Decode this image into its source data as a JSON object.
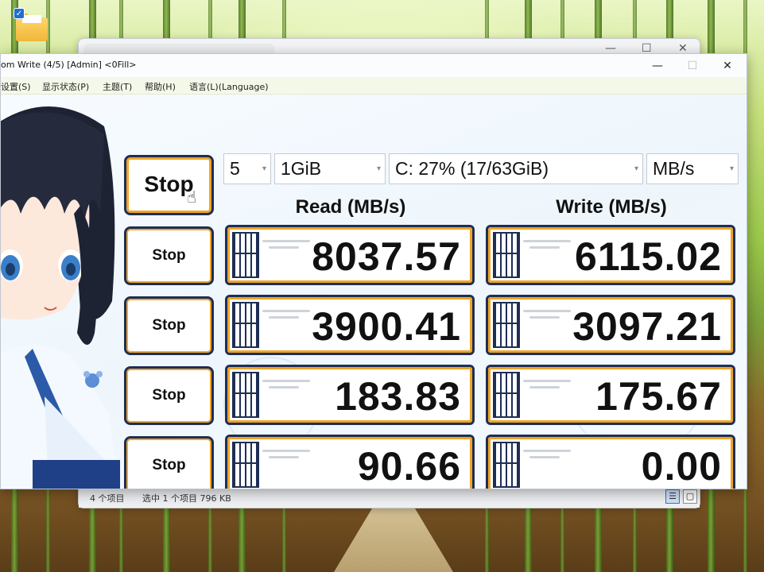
{
  "desktop": {
    "icon_name": "folder-icon"
  },
  "explorer": {
    "status": {
      "item_count": "4 个项目",
      "selection": "选中 1 个项目  796 KB"
    }
  },
  "cdm": {
    "title": "om Write (4/5) [Admin] <0Fill>",
    "window_controls": {
      "minimize": "—",
      "maximize": "☐",
      "close": "✕"
    },
    "menu": [
      "设置(S)",
      "显示状态(P)",
      "主题(T)",
      "帮助(H)",
      "语言(L)(Language)"
    ],
    "main_button_label": "Stop",
    "row_buttons": [
      "Stop",
      "Stop",
      "Stop",
      "Stop"
    ],
    "selects": {
      "count": "5",
      "size": "1GiB",
      "drive": "C: 27% (17/63GiB)",
      "unit": "MB/s"
    },
    "headers": {
      "read": "Read (MB/s)",
      "write": "Write (MB/s)"
    },
    "results": [
      {
        "read": "8037.57",
        "write": "6115.02"
      },
      {
        "read": "3900.41",
        "write": "3097.21"
      },
      {
        "read": "183.83",
        "write": "175.67"
      },
      {
        "read": "90.66",
        "write": "0.00"
      }
    ],
    "accent_color": "#f0a526",
    "frame_color": "#1e2e55"
  }
}
